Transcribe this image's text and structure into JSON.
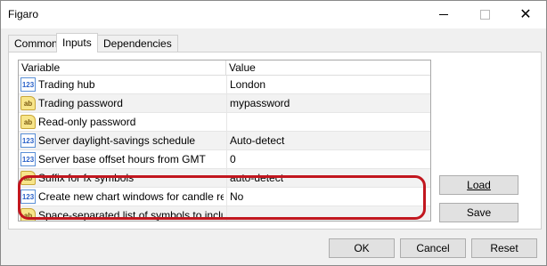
{
  "window": {
    "title": "Figaro"
  },
  "tabs": [
    {
      "label": "Common"
    },
    {
      "label": "Inputs"
    },
    {
      "label": "Dependencies"
    }
  ],
  "grid": {
    "columns": {
      "variable": "Variable",
      "value": "Value"
    },
    "rows": [
      {
        "icon": "123",
        "type": "numeric",
        "variable": "Trading hub",
        "value": "London"
      },
      {
        "icon": "ab",
        "type": "string",
        "variable": "Trading password",
        "value": "mypassword"
      },
      {
        "icon": "ab",
        "type": "string",
        "variable": "Read-only password",
        "value": ""
      },
      {
        "icon": "123",
        "type": "numeric",
        "variable": "Server daylight-savings schedule",
        "value": "Auto-detect"
      },
      {
        "icon": "123",
        "type": "numeric",
        "variable": "Server base offset hours from GMT",
        "value": "0"
      },
      {
        "icon": "ab",
        "type": "string",
        "variable": "Suffix for fx symbols",
        "value": "auto-detect"
      },
      {
        "icon": "123",
        "type": "numeric",
        "variable": "Create new chart windows for candle req...",
        "value": "No"
      },
      {
        "icon": "ab",
        "type": "string",
        "variable": "Space-separated list of symbols to include...",
        "value": ""
      }
    ]
  },
  "buttons": {
    "load": "Load",
    "save": "Save",
    "ok": "OK",
    "cancel": "Cancel",
    "reset": "Reset"
  },
  "annotation": {
    "color": "#c2171f"
  }
}
